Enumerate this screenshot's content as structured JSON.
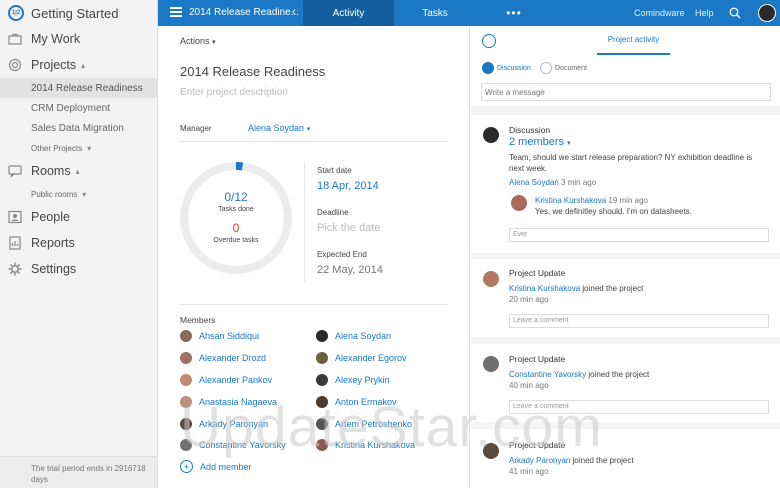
{
  "sidebar": {
    "brand": {
      "title": "Getting Started",
      "logo": "1|2"
    },
    "items": [
      {
        "label": "My Work",
        "icon": "briefcase-icon"
      },
      {
        "label": "Projects",
        "icon": "target-icon"
      },
      {
        "label": "Rooms",
        "icon": "chat-icon"
      },
      {
        "label": "People",
        "icon": "people-icon"
      },
      {
        "label": "Reports",
        "icon": "chart-icon"
      },
      {
        "label": "Settings",
        "icon": "gear-icon"
      }
    ],
    "projects": [
      "2014 Release Readiness",
      "CRM Deployment",
      "Sales Data Migration",
      "Other Projects"
    ],
    "rooms": [
      "Public rooms"
    ],
    "trial": "The trial period ends in 2916718 days"
  },
  "topbar": {
    "title": "2014 Release Readine...",
    "back": "‹",
    "tabs": [
      "Activity",
      "Tasks",
      "•••"
    ],
    "links": [
      "Comindware",
      "Help"
    ]
  },
  "project": {
    "actions": "Actions",
    "title": "2014 Release Readiness",
    "description_placeholder": "Enter project description",
    "manager_label": "Manager",
    "manager": "Alena Soydan",
    "tasks": {
      "count": "0/12",
      "label": "Tasks done",
      "overdue": "0",
      "overdue_label": "Overdue tasks",
      "progress": 0.02
    },
    "start_label": "Start date",
    "start": "18 Apr, 2014",
    "deadline_label": "Deadline",
    "deadline": "Pick the date",
    "end_label": "Expected End",
    "end": "22 May, 2014",
    "members_label": "Members",
    "members_col1": [
      "Ahsan Siddiqui",
      "Alexander Drozd",
      "Alexander Pankov",
      "Anastasia Nagaeva",
      "Arkady Paronyan",
      "Constantine Yavorsky"
    ],
    "members_col2": [
      "Alena Soydan",
      "Alexander Egorov",
      "Alexey Prykin",
      "Anton Ermakov",
      "Artem Petroshenko",
      "Kristina Kurshakova"
    ],
    "add_member": "Add member"
  },
  "activity": {
    "tab": "Project activity",
    "toggles": [
      "Discussion",
      "Document"
    ],
    "message_placeholder": "Write a message",
    "discussion": {
      "title": "Discussion",
      "members": "2 members",
      "text1": "Team, should we start release preparation? NY exhibition deadline is",
      "text2": "next week.",
      "author": "Alena Soydan",
      "time": "3 min ago",
      "reply_author": "Kristina Kurshakova",
      "reply_time": "19 min ago",
      "reply_text": "Yes, we definitley should. I'm on datasheets.",
      "reply_input": "Ever"
    },
    "updates": [
      {
        "title": "Project Update",
        "who": "Kristina Kurshakova",
        "what": "joined the project",
        "time": "20 min ago",
        "input": "Leave a comment"
      },
      {
        "title": "Project Update",
        "who": "Constantine Yavorsky",
        "what": "joined the project",
        "time": "40 min ago",
        "input": "Leave a comment"
      },
      {
        "title": "Project Update",
        "who": "Arkady Paronyan",
        "what": "joined the project",
        "time": "41 min ago"
      }
    ]
  },
  "watermark": "UpdateStar.com",
  "colors": {
    "accent": "#1b78c4",
    "accent_dark": "#155f9e",
    "progress": "#1b78c4",
    "ring": "#ececec"
  }
}
